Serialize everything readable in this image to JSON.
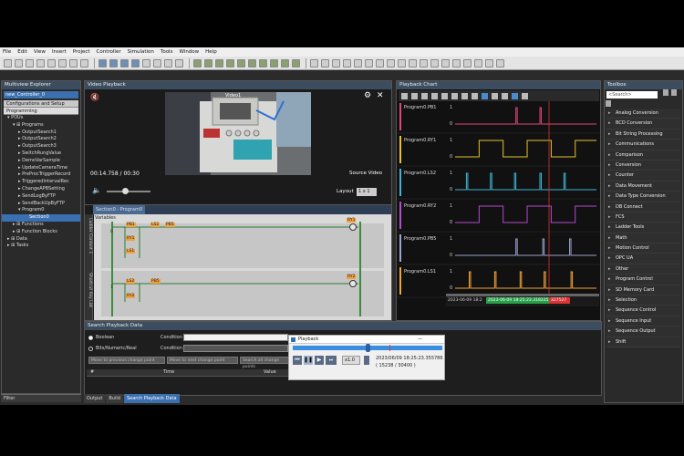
{
  "menu": [
    "File",
    "Edit",
    "View",
    "Insert",
    "Project",
    "Controller",
    "Simulation",
    "Tools",
    "Window",
    "Help"
  ],
  "explorer": {
    "title": "Multiview Explorer",
    "controller": "new_Controller_0",
    "tabs": [
      "Configurations and Setup",
      "Programming"
    ],
    "tree": [
      {
        "label": "▾ POUs",
        "indent": 1
      },
      {
        "label": "▾ ⊞ Programs",
        "indent": 2
      },
      {
        "label": "▸ OutputSearch1",
        "indent": 3
      },
      {
        "label": "▸ OutputSearch2",
        "indent": 3
      },
      {
        "label": "▸ OutputSearch3",
        "indent": 3
      },
      {
        "label": "▸ SwitchRungValue",
        "indent": 3
      },
      {
        "label": "▸ DemoVarSample",
        "indent": 3
      },
      {
        "label": "▸ UpdateCameraTime",
        "indent": 3
      },
      {
        "label": "▸ PreProcTriggerRecord",
        "indent": 3
      },
      {
        "label": "▸ TriggeredIntervalRec",
        "indent": 3
      },
      {
        "label": "▸ ChangeAPBSetting",
        "indent": 3
      },
      {
        "label": "▸ SendLogByFTP",
        "indent": 3
      },
      {
        "label": "▸ SendBackUpByFTP",
        "indent": 3
      },
      {
        "label": "▾ Program0",
        "indent": 3
      },
      {
        "label": "Section0",
        "indent": 5,
        "hl": true
      },
      {
        "label": "▸ ⊞ Functions",
        "indent": 2
      },
      {
        "label": "▸ ⊞ Function Blocks",
        "indent": 2
      },
      {
        "label": "▸ ⊞ Data",
        "indent": 1
      },
      {
        "label": "▸ ⊞ Tasks",
        "indent": 1
      }
    ],
    "filter": "Filter"
  },
  "video": {
    "title": "Video Playback",
    "overlay": "Video1",
    "time": "00:14.758 / 00:30",
    "source": "Source Video",
    "layout_label": "Layout",
    "layout_value": "1 x 1"
  },
  "ladder": {
    "tabs": [
      "Section0 - Program0"
    ],
    "vertical_tabs": [
      "Ladder Content 1",
      "Shortcut Key List"
    ],
    "variables": "Variables",
    "contacts": [
      "PB1",
      "LS2",
      "PB5",
      "RY1",
      "LS1",
      "LS2",
      "PB5",
      "RY2"
    ],
    "rows": [
      "0",
      "",
      "",
      "",
      "1"
    ],
    "coils": [
      "RY1",
      "RY2"
    ]
  },
  "chart": {
    "title": "Playback Chart",
    "signals": [
      {
        "name": "Program0.PB1",
        "color": "#e0457b",
        "pattern": "pulse",
        "pulses": [
          0.43,
          0.6
        ]
      },
      {
        "name": "Program0.RY1",
        "color": "#e8c32e",
        "pattern": "square",
        "period": 0.17
      },
      {
        "name": "Program0.LS2",
        "color": "#3fb6d8",
        "pattern": "pulse",
        "pulses": [
          0.08,
          0.25,
          0.42,
          0.6,
          0.77
        ]
      },
      {
        "name": "Program0.RY2",
        "color": "#b44bd0",
        "pattern": "square",
        "period": 0.17
      },
      {
        "name": "Program0.PB5",
        "color": "#9fa2cf",
        "pattern": "pulse",
        "pulses": [
          0.43,
          0.62,
          0.81
        ]
      },
      {
        "name": "Program0.LS1",
        "color": "#f2a33a",
        "pattern": "pulse",
        "pulses": [
          0.1,
          0.28,
          0.46,
          0.63,
          0.82
        ]
      }
    ],
    "timestamp_left": "2023-06-09 18:2",
    "timestamp_mid": "2023-06-09 18:25:23.318335",
    "timestamp_right": "327527"
  },
  "toolbox": {
    "title": "Toolbox",
    "search": "<Search>",
    "categories": [
      "Analog Conversion",
      "BCD Conversion",
      "Bit String Processing",
      "Communications",
      "Comparison",
      "Conversion",
      "Counter",
      "Data Movement",
      "Data Type Conversion",
      "DB Connect",
      "FCS",
      "Ladder Tools",
      "Math",
      "Motion Control",
      "OPC UA",
      "Other",
      "Program Control",
      "SD Memory Card",
      "Selection",
      "Sequence Control",
      "Sequence Input",
      "Sequence Output",
      "Shift"
    ]
  },
  "search": {
    "title": "Search Playback Data",
    "radio1": "Boolean",
    "radio2": "Bits/Numeric/Real",
    "condition": "Condition",
    "buttons": [
      "Move to previous change point",
      "Move to next change point",
      "Search all change points"
    ],
    "columns": [
      "#",
      "Time",
      "Value"
    ]
  },
  "popup": {
    "title": "Playback",
    "speed": "x1.0",
    "timestamp": "2023/06/09 18:25:23.355786",
    "frames": "( 15238 / 30400 )"
  },
  "bottom_tabs": [
    "Output",
    "Build",
    "Search Playback Data"
  ]
}
